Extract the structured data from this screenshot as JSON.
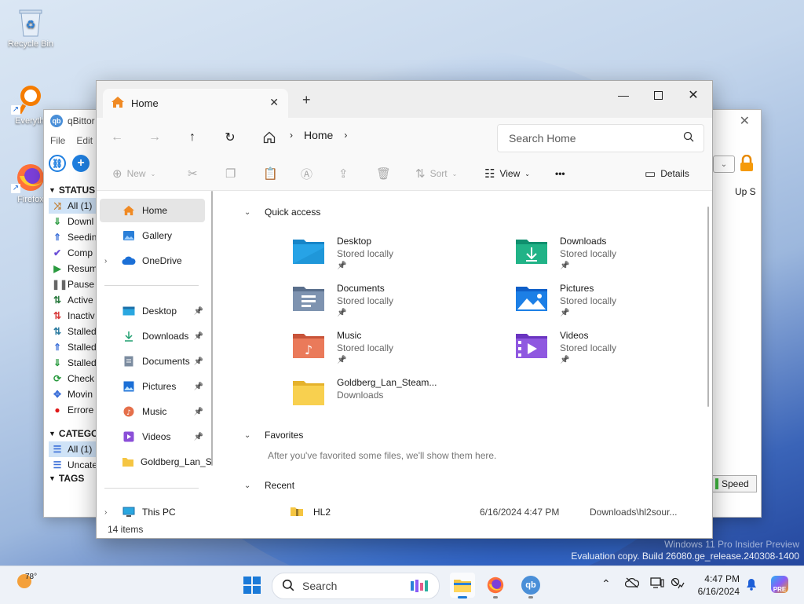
{
  "desktop": {
    "icons": [
      {
        "label": "Recycle Bin",
        "icon": "recycle-bin-icon"
      },
      {
        "label": "Everythi",
        "icon": "everything-search-icon"
      },
      {
        "label": "Firefox",
        "icon": "firefox-icon"
      }
    ]
  },
  "qbittorrent": {
    "title": "qBittor",
    "menu": [
      "File",
      "Edit"
    ],
    "status_header": "STATUS",
    "status_items": [
      {
        "label": "All (1)",
        "icon": "shuffle-icon",
        "color": "#c07a2b"
      },
      {
        "label": "Downl",
        "icon": "download-icon",
        "color": "#2a9a3f"
      },
      {
        "label": "Seedin",
        "icon": "upload-icon",
        "color": "#3b6fd8"
      },
      {
        "label": "Comp",
        "icon": "check-icon",
        "color": "#6b4fd8"
      },
      {
        "label": "Resum",
        "icon": "play-icon",
        "color": "#2a9a3f"
      },
      {
        "label": "Pause",
        "icon": "pause-icon",
        "color": "#666666"
      },
      {
        "label": "Active",
        "icon": "active-icon",
        "color": "#2a7a3f"
      },
      {
        "label": "Inactiv",
        "icon": "inactive-icon",
        "color": "#d83b3b"
      },
      {
        "label": "Stalled",
        "icon": "stalled-icon",
        "color": "#2a7a9f"
      },
      {
        "label": "Stalled",
        "icon": "stalled-up-icon",
        "color": "#3b6fd8"
      },
      {
        "label": "Stalled",
        "icon": "stalled-down-icon",
        "color": "#2a9a3f"
      },
      {
        "label": "Check",
        "icon": "refresh-icon",
        "color": "#2a9a3f"
      },
      {
        "label": "Movin",
        "icon": "move-icon",
        "color": "#3b6fd8"
      },
      {
        "label": "Errore",
        "icon": "error-icon",
        "color": "#e01818"
      }
    ],
    "category_header": "CATEGO",
    "category_items": [
      {
        "label": "All (1)",
        "icon": "list-icon"
      },
      {
        "label": "Uncate",
        "icon": "list-icon"
      }
    ],
    "tags_header": "TAGS",
    "column_header": "Up S",
    "speed_label": "Speed"
  },
  "explorer": {
    "tab_label": "Home",
    "breadcrumb": [
      "Home"
    ],
    "search_placeholder": "Search Home",
    "commands": {
      "new": "New",
      "sort": "Sort",
      "view": "View",
      "more": "•••",
      "details": "Details"
    },
    "nav": {
      "home": "Home",
      "gallery": "Gallery",
      "onedrive": "OneDrive",
      "pinned": [
        {
          "label": "Desktop",
          "icon": "desktop-icon"
        },
        {
          "label": "Downloads",
          "icon": "download-icon"
        },
        {
          "label": "Documents",
          "icon": "document-icon"
        },
        {
          "label": "Pictures",
          "icon": "picture-icon"
        },
        {
          "label": "Music",
          "icon": "music-icon"
        },
        {
          "label": "Videos",
          "icon": "video-icon"
        },
        {
          "label": "Goldberg_Lan_S",
          "icon": "folder-icon"
        }
      ],
      "this_pc": "This PC"
    },
    "quick_access": {
      "header": "Quick access",
      "items": [
        {
          "name": "Desktop",
          "sub": "Stored locally",
          "icon": "desktop-folder-icon",
          "pinned": true
        },
        {
          "name": "Downloads",
          "sub": "Stored locally",
          "icon": "downloads-folder-icon",
          "pinned": true
        },
        {
          "name": "Documents",
          "sub": "Stored locally",
          "icon": "documents-folder-icon",
          "pinned": true
        },
        {
          "name": "Pictures",
          "sub": "Stored locally",
          "icon": "pictures-folder-icon",
          "pinned": true
        },
        {
          "name": "Music",
          "sub": "Stored locally",
          "icon": "music-folder-icon",
          "pinned": true
        },
        {
          "name": "Videos",
          "sub": "Stored locally",
          "icon": "videos-folder-icon",
          "pinned": true
        },
        {
          "name": "Goldberg_Lan_Steam...",
          "sub": "Downloads",
          "icon": "folder-icon",
          "pinned": false
        }
      ]
    },
    "favorites": {
      "header": "Favorites",
      "empty_text": "After you've favorited some files, we'll show them here."
    },
    "recent": {
      "header": "Recent",
      "rows": [
        {
          "name": "HL2",
          "date": "6/16/2024 4:47 PM",
          "location": "Downloads\\hl2sour..."
        }
      ]
    },
    "status": "14 items"
  },
  "watermark": {
    "line1": "Windows 11 Pro Insider Preview",
    "line2": "Evaluation copy. Build 26080.ge_release.240308-1400"
  },
  "taskbar": {
    "weather_temp": "78°",
    "search_label": "Search",
    "clock_time": "4:47 PM",
    "clock_date": "6/16/2024",
    "copilot_badge": "PRE"
  }
}
